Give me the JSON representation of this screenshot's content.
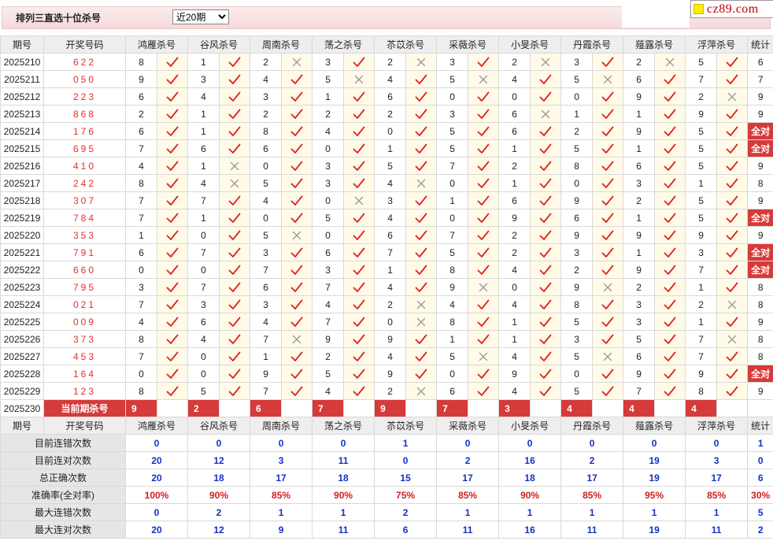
{
  "header": {
    "title": "排列三直选十位杀号",
    "period_select": {
      "selected": "近20期",
      "options": [
        "近20期"
      ]
    },
    "logo_text": "cz89.com"
  },
  "columns": {
    "period": "期号",
    "draw": "开奖号码",
    "experts": [
      "鸿雁杀号",
      "谷风杀号",
      "周南杀号",
      "荡之杀号",
      "苶苡杀号",
      "采薇杀号",
      "小旻杀号",
      "丹霞杀号",
      "薤露杀号",
      "浮萍杀号"
    ],
    "stat": "统计"
  },
  "rows": [
    {
      "period": "2025210",
      "draw": "622",
      "k": [
        8,
        1,
        2,
        3,
        2,
        3,
        2,
        3,
        2,
        5
      ],
      "r": [
        1,
        1,
        0,
        1,
        0,
        1,
        0,
        1,
        0,
        1
      ],
      "stat": "6"
    },
    {
      "period": "2025211",
      "draw": "050",
      "k": [
        9,
        3,
        4,
        5,
        4,
        5,
        4,
        5,
        6,
        7
      ],
      "r": [
        1,
        1,
        1,
        0,
        1,
        0,
        1,
        0,
        1,
        1
      ],
      "stat": "7"
    },
    {
      "period": "2025212",
      "draw": "223",
      "k": [
        6,
        4,
        3,
        1,
        6,
        0,
        0,
        0,
        9,
        2
      ],
      "r": [
        1,
        1,
        1,
        1,
        1,
        1,
        1,
        1,
        1,
        0
      ],
      "stat": "9"
    },
    {
      "period": "2025213",
      "draw": "868",
      "k": [
        2,
        1,
        2,
        2,
        2,
        3,
        6,
        1,
        1,
        9
      ],
      "r": [
        1,
        1,
        1,
        1,
        1,
        1,
        0,
        1,
        1,
        1
      ],
      "stat": "9"
    },
    {
      "period": "2025214",
      "draw": "176",
      "k": [
        6,
        1,
        8,
        4,
        0,
        5,
        6,
        2,
        9,
        5
      ],
      "r": [
        1,
        1,
        1,
        1,
        1,
        1,
        1,
        1,
        1,
        1
      ],
      "stat": "全对"
    },
    {
      "period": "2025215",
      "draw": "695",
      "k": [
        7,
        6,
        6,
        0,
        1,
        5,
        1,
        5,
        1,
        5
      ],
      "r": [
        1,
        1,
        1,
        1,
        1,
        1,
        1,
        1,
        1,
        1
      ],
      "stat": "全对"
    },
    {
      "period": "2025216",
      "draw": "410",
      "k": [
        4,
        1,
        0,
        3,
        5,
        7,
        2,
        8,
        6,
        5
      ],
      "r": [
        1,
        0,
        1,
        1,
        1,
        1,
        1,
        1,
        1,
        1
      ],
      "stat": "9"
    },
    {
      "period": "2025217",
      "draw": "242",
      "k": [
        8,
        4,
        5,
        3,
        4,
        0,
        1,
        0,
        3,
        1
      ],
      "r": [
        1,
        0,
        1,
        1,
        0,
        1,
        1,
        1,
        1,
        1
      ],
      "stat": "8"
    },
    {
      "period": "2025218",
      "draw": "307",
      "k": [
        7,
        7,
        4,
        0,
        3,
        1,
        6,
        9,
        2,
        5
      ],
      "r": [
        1,
        1,
        1,
        0,
        1,
        1,
        1,
        1,
        1,
        1
      ],
      "stat": "9"
    },
    {
      "period": "2025219",
      "draw": "784",
      "k": [
        7,
        1,
        0,
        5,
        4,
        0,
        9,
        6,
        1,
        5
      ],
      "r": [
        1,
        1,
        1,
        1,
        1,
        1,
        1,
        1,
        1,
        1
      ],
      "stat": "全对"
    },
    {
      "period": "2025220",
      "draw": "353",
      "k": [
        1,
        0,
        5,
        0,
        6,
        7,
        2,
        9,
        9,
        9
      ],
      "r": [
        1,
        1,
        0,
        1,
        1,
        1,
        1,
        1,
        1,
        1
      ],
      "stat": "9"
    },
    {
      "period": "2025221",
      "draw": "791",
      "k": [
        6,
        7,
        3,
        6,
        7,
        5,
        2,
        3,
        1,
        3
      ],
      "r": [
        1,
        1,
        1,
        1,
        1,
        1,
        1,
        1,
        1,
        1
      ],
      "stat": "全对"
    },
    {
      "period": "2025222",
      "draw": "660",
      "k": [
        0,
        0,
        7,
        3,
        1,
        8,
        4,
        2,
        9,
        7
      ],
      "r": [
        1,
        1,
        1,
        1,
        1,
        1,
        1,
        1,
        1,
        1
      ],
      "stat": "全对"
    },
    {
      "period": "2025223",
      "draw": "795",
      "k": [
        3,
        7,
        6,
        7,
        4,
        9,
        0,
        9,
        2,
        1
      ],
      "r": [
        1,
        1,
        1,
        1,
        1,
        0,
        1,
        0,
        1,
        1
      ],
      "stat": "8"
    },
    {
      "period": "2025224",
      "draw": "021",
      "k": [
        7,
        3,
        3,
        4,
        2,
        4,
        4,
        8,
        3,
        2
      ],
      "r": [
        1,
        1,
        1,
        1,
        0,
        1,
        1,
        1,
        1,
        0
      ],
      "stat": "8"
    },
    {
      "period": "2025225",
      "draw": "009",
      "k": [
        4,
        6,
        4,
        7,
        0,
        8,
        1,
        5,
        3,
        1
      ],
      "r": [
        1,
        1,
        1,
        1,
        0,
        1,
        1,
        1,
        1,
        1
      ],
      "stat": "9"
    },
    {
      "period": "2025226",
      "draw": "373",
      "k": [
        8,
        4,
        7,
        9,
        9,
        1,
        1,
        3,
        5,
        7
      ],
      "r": [
        1,
        1,
        0,
        1,
        1,
        1,
        1,
        1,
        1,
        0
      ],
      "stat": "8"
    },
    {
      "period": "2025227",
      "draw": "453",
      "k": [
        7,
        0,
        1,
        2,
        4,
        5,
        4,
        5,
        6,
        7
      ],
      "r": [
        1,
        1,
        1,
        1,
        1,
        0,
        1,
        0,
        1,
        1
      ],
      "stat": "8"
    },
    {
      "period": "2025228",
      "draw": "164",
      "k": [
        0,
        0,
        9,
        5,
        9,
        0,
        9,
        0,
        9,
        9
      ],
      "r": [
        1,
        1,
        1,
        1,
        1,
        1,
        1,
        1,
        1,
        1
      ],
      "stat": "全对"
    },
    {
      "period": "2025229",
      "draw": "123",
      "k": [
        8,
        5,
        7,
        4,
        2,
        6,
        4,
        5,
        7,
        8
      ],
      "r": [
        1,
        1,
        1,
        1,
        0,
        1,
        1,
        1,
        1,
        1
      ],
      "stat": "9"
    }
  ],
  "current": {
    "period": "2025230",
    "label": "当前期杀号",
    "kills": [
      "9",
      "2",
      "6",
      "7",
      "9",
      "7",
      "3",
      "4",
      "4",
      "4"
    ]
  },
  "stats": [
    {
      "label": "目前连错次数",
      "values": [
        "0",
        "0",
        "0",
        "0",
        "1",
        "0",
        "0",
        "0",
        "0",
        "0"
      ],
      "stat": "1"
    },
    {
      "label": "目前连对次数",
      "values": [
        "20",
        "12",
        "3",
        "11",
        "0",
        "2",
        "16",
        "2",
        "19",
        "3"
      ],
      "stat": "0"
    },
    {
      "label": "总正确次数",
      "values": [
        "20",
        "18",
        "17",
        "18",
        "15",
        "17",
        "18",
        "17",
        "19",
        "17"
      ],
      "stat": "6"
    },
    {
      "label": "准确率(全对率)",
      "values": [
        "100%",
        "90%",
        "85%",
        "90%",
        "75%",
        "85%",
        "90%",
        "85%",
        "95%",
        "85%"
      ],
      "stat": "30%"
    },
    {
      "label": "最大连错次数",
      "values": [
        "0",
        "2",
        "1",
        "1",
        "2",
        "1",
        "1",
        "1",
        "1",
        "1"
      ],
      "stat": "5"
    },
    {
      "label": "最大连对次数",
      "values": [
        "20",
        "12",
        "9",
        "11",
        "6",
        "11",
        "16",
        "11",
        "19",
        "11"
      ],
      "stat": "2"
    }
  ],
  "colors": {
    "accent_red": "#d63a3a",
    "check_red": "#e02020",
    "stat_blue": "#1530c8",
    "cross_gray": "#999999"
  }
}
